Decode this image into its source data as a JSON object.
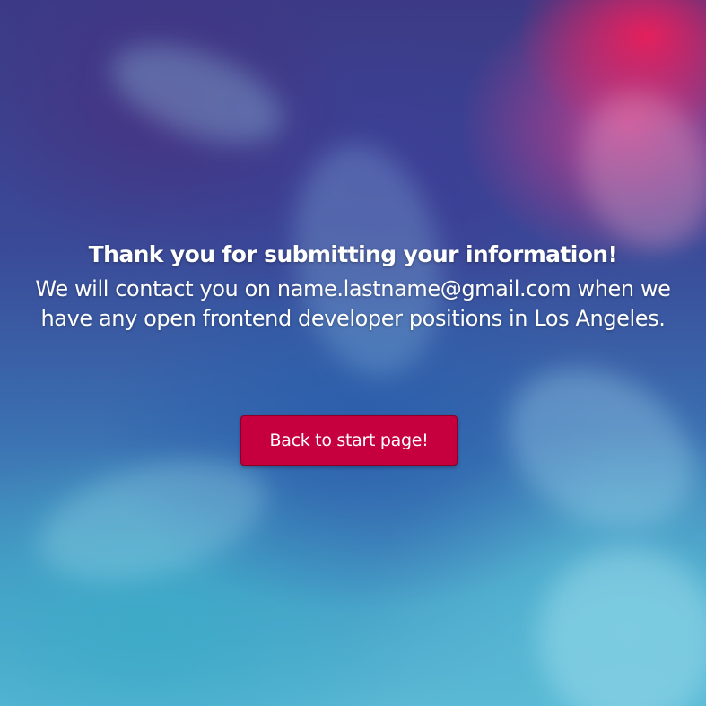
{
  "confirmation": {
    "title": "Thank you for submitting your information!",
    "message": "We will contact you on name.lastname@gmail.com when we have any open frontend developer positions in Los Angeles.",
    "back_button_label": "Back to start page!"
  },
  "colors": {
    "button_background": "#c6003e",
    "text": "#ffffff",
    "background_top": "#3c3a86",
    "background_bottom": "#5ab8d4",
    "accent_pink": "#eb1e5a"
  }
}
